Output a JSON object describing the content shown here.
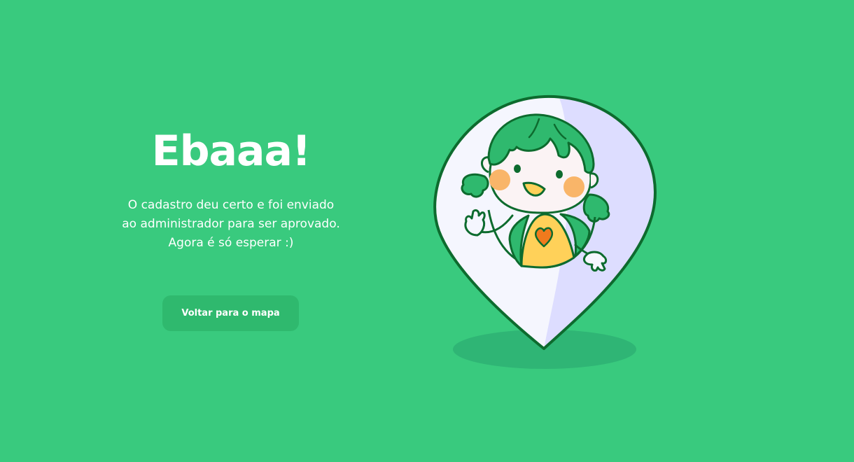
{
  "success": {
    "title": "Ebaaa!",
    "message_line1": "O cadastro deu certo e foi enviado",
    "message_line2": "ao administrador para ser aprovado.",
    "message_line3": "Agora é só esperar :)",
    "button_label": "Voltar para o mapa"
  },
  "illustration": {
    "icon": "map-pin-girl-illustration",
    "pin_fill": "#F5F6FE",
    "pin_shade": "#DDDDFF",
    "outline": "#0D6B2E",
    "hair": "#2FB96E",
    "cheeks": "#F9B569",
    "shirt": "#FFD159",
    "heart": "#F07A1D",
    "shadow": "#2FB575"
  },
  "colors": {
    "background": "#39CA7E",
    "button": "#2FB96E",
    "text": "#FFFFFF"
  }
}
